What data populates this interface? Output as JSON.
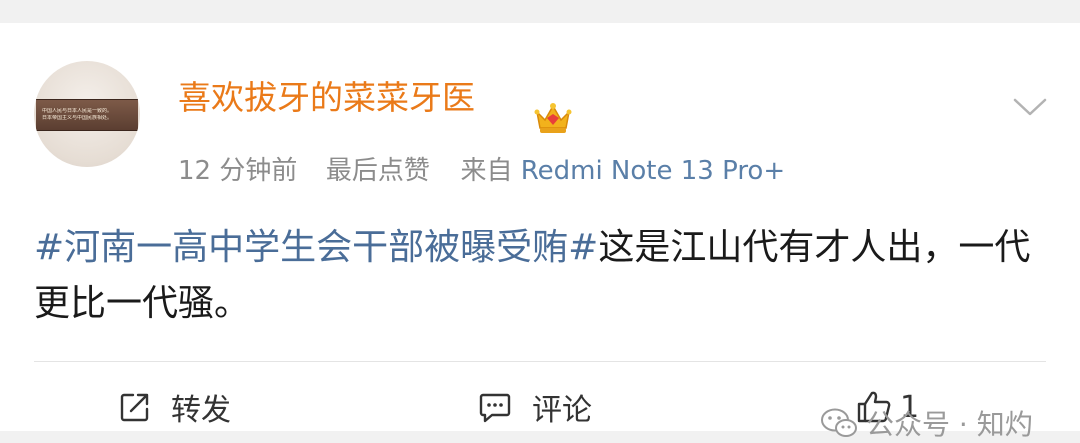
{
  "post": {
    "username": "喜欢拔牙的菜菜牙医",
    "time": "12 分钟前",
    "last_like": "最后点赞",
    "source_prefix": "来自",
    "device": "Redmi Note 13 Pro+",
    "topic": "#河南一高中学生会干部被曝受贿#",
    "text": "这是江山代有才人出，一代更比一代骚。",
    "avatar_caption_line1": "中国人民与日本人民是一致的。",
    "avatar_caption_line2": "日本帝国主义与中国民族相处。"
  },
  "actions": {
    "repost_label": "转发",
    "comment_label": "评论",
    "like_count": "1"
  },
  "watermark": {
    "text": "公众号 · 知灼"
  },
  "icons": {
    "crown": "crown-icon",
    "more": "chevron-down-icon",
    "repost": "repost-icon",
    "comment": "comment-icon",
    "like": "thumbs-up-icon",
    "wechat": "wechat-icon"
  },
  "colors": {
    "username": "#ea7a19",
    "topic": "#4a6d98",
    "device": "#5a7fa8"
  }
}
